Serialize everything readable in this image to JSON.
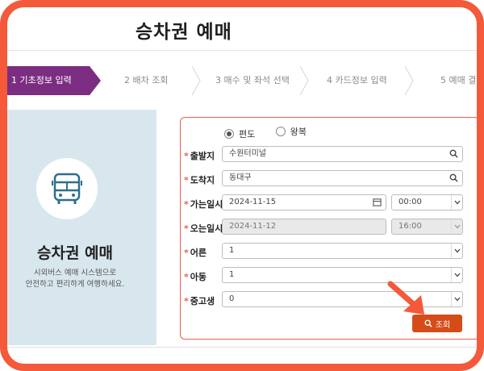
{
  "header": {
    "title": "승차권 예매"
  },
  "steps": [
    {
      "label": "1 기초정보 입력",
      "active": true
    },
    {
      "label": "2 배차 조회",
      "active": false
    },
    {
      "label": "3 매수 및 좌석 선택",
      "active": false
    },
    {
      "label": "4 카드정보 입력",
      "active": false
    },
    {
      "label": "5 예매 결",
      "active": false
    }
  ],
  "left_panel": {
    "icon": "bus-icon",
    "title": "승차권 예매",
    "desc_line1": "시외버스 예매 시스템으로",
    "desc_line2": "안전하고 편리하게 여행하세요."
  },
  "form": {
    "trip_type": {
      "oneway": "편도",
      "roundtrip": "왕복",
      "selected": "oneway"
    },
    "departure": {
      "label": "출발지",
      "value": "수원터미널"
    },
    "arrival": {
      "label": "도착지",
      "value": "동대구"
    },
    "go_date": {
      "label": "가는일시",
      "date": "2024-11-15",
      "time": "00:00"
    },
    "return_date": {
      "label": "오는일시",
      "date": "2024-11-12",
      "time": "16:00"
    },
    "adult": {
      "label": "어른",
      "value": "1"
    },
    "child": {
      "label": "아동",
      "value": "1"
    },
    "student": {
      "label": "중고생",
      "value": "0"
    },
    "search_button": "조회"
  },
  "colors": {
    "accent": "#7b2d81",
    "frame": "#f4593a",
    "button": "#d44d19",
    "panel": "#d8e7ee"
  }
}
